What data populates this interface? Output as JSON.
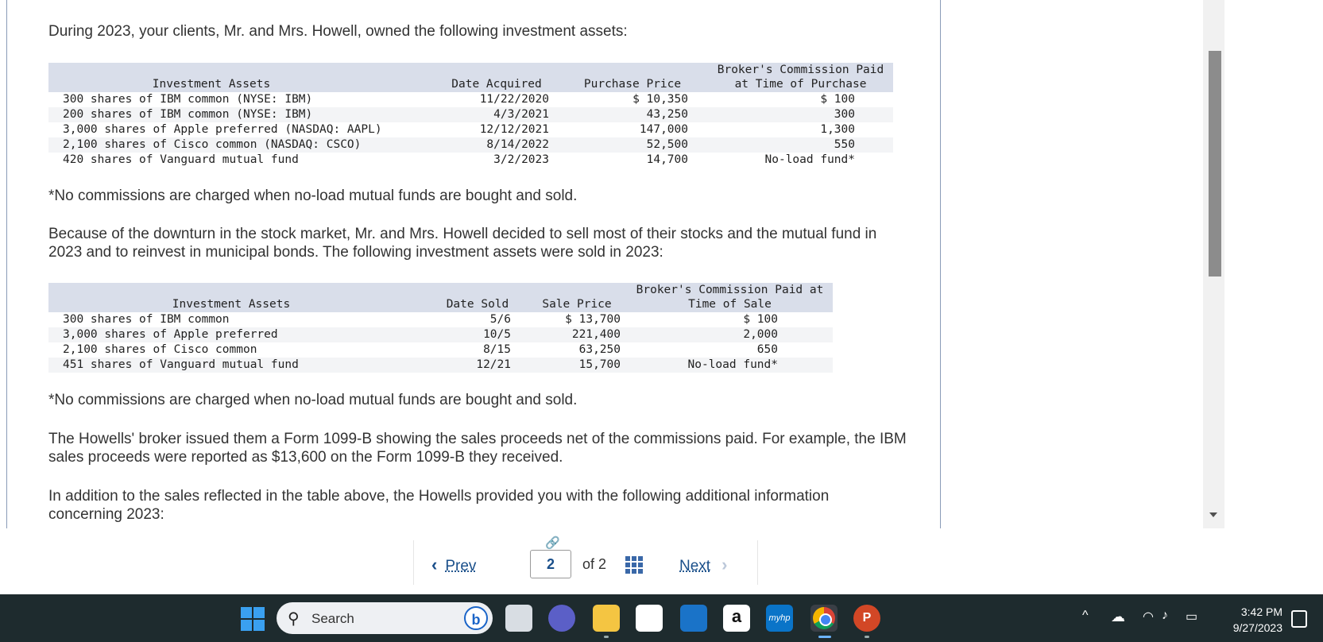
{
  "content": {
    "intro": "During 2023, your clients, Mr. and Mrs. Howell, owned the following investment assets:",
    "note1": "*No commissions are charged when no-load mutual funds are bought and sold.",
    "para2": "Because of the downturn in the stock market, Mr. and Mrs. Howell decided to sell most of their stocks and the mutual fund in 2023 and to reinvest in municipal bonds. The following investment assets were sold in 2023:",
    "note2": "*No commissions are charged when no-load mutual funds are bought and sold.",
    "para3": "The Howells' broker issued them a Form 1099-B showing the sales proceeds net of the commissions paid. For example, the IBM sales proceeds were reported as $13,600 on the Form 1099-B they received.",
    "para4": "In addition to the sales reflected in the table above, the Howells provided you with the following additional information concerning 2023:"
  },
  "table1": {
    "headers": {
      "asset": "Investment Assets",
      "date": "Date Acquired",
      "price": "Purchase Price",
      "commission_line1": "Broker's Commission Paid",
      "commission_line2": "at Time of Purchase"
    },
    "rows": [
      {
        "asset": "300 shares of IBM common (NYSE: IBM)",
        "date": "11/22/2020",
        "price": "$ 10,350",
        "commission": "$ 100"
      },
      {
        "asset": "200 shares of IBM common (NYSE: IBM)",
        "date": "4/3/2021",
        "price": "43,250",
        "commission": "300"
      },
      {
        "asset": "3,000 shares of Apple preferred (NASDAQ: AAPL)",
        "date": "12/12/2021",
        "price": "147,000",
        "commission": "1,300"
      },
      {
        "asset": "2,100 shares of Cisco common (NASDAQ: CSCO)",
        "date": "8/14/2022",
        "price": "52,500",
        "commission": "550"
      },
      {
        "asset": "420 shares of Vanguard mutual fund",
        "date": "3/2/2023",
        "price": "14,700",
        "commission": "No-load fund*"
      }
    ]
  },
  "table2": {
    "headers": {
      "asset": "Investment Assets",
      "date": "Date Sold",
      "price": "Sale Price",
      "commission_line1": "Broker's Commission Paid at",
      "commission_line2": "Time of Sale"
    },
    "rows": [
      {
        "asset": "300 shares of IBM common",
        "date": "5/6",
        "price": "$ 13,700",
        "commission": "$ 100"
      },
      {
        "asset": "3,000 shares of Apple preferred",
        "date": "10/5",
        "price": "221,400",
        "commission": "2,000"
      },
      {
        "asset": "2,100 shares of Cisco common",
        "date": "8/15",
        "price": "63,250",
        "commission": "650"
      },
      {
        "asset": "451 shares of Vanguard mutual fund",
        "date": "12/21",
        "price": "15,700",
        "commission": "No-load fund*"
      }
    ]
  },
  "pager": {
    "prev_label": "Prev",
    "current_page": "2",
    "of_label": "of 2",
    "next_label": "Next"
  },
  "taskbar": {
    "search_label": "Search",
    "time": "3:42 PM",
    "date": "9/27/2023",
    "icons": [
      "windows-start-icon",
      "search-icon",
      "bing-icon",
      "task-view-icon",
      "teams-chat-icon",
      "file-explorer-icon",
      "microsoft-store-icon",
      "mail-icon",
      "amazon-icon",
      "myhp-icon",
      "chrome-icon",
      "powerpoint-icon",
      "chevron-up-icon",
      "onedrive-icon",
      "wifi-icon",
      "volume-icon",
      "battery-icon",
      "notification-icon"
    ]
  }
}
